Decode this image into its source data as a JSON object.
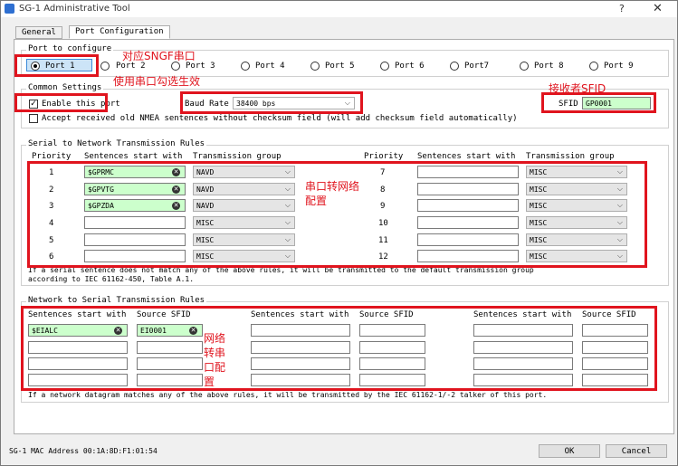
{
  "window": {
    "title": "SG-1 Administrative Tool",
    "help": "?",
    "close": "✕"
  },
  "tabs": [
    "General",
    "Port Configuration"
  ],
  "port_group": {
    "title": "Port to configure",
    "ports": [
      "Port 1",
      "Port 2",
      "Port 3",
      "Port 4",
      "Port 5",
      "Port 6",
      "Port7",
      "Port 8",
      "Port 9"
    ],
    "selected": "Port 1"
  },
  "common": {
    "title": "Common Settings",
    "enable_label": "Enable this port",
    "baud_label": "Baud Rate",
    "baud_value": "38400 bps",
    "sfid_label": "SFID",
    "sfid_value": "GP0001",
    "accept_label": "Accept received old NMEA sentences without checksum field (will add checksum field automatically)"
  },
  "serial_rules": {
    "title": "Serial to Network Transmission Rules",
    "headers": {
      "priority": "Priority",
      "sentence": "Sentences start with",
      "group": "Transmission group"
    },
    "left": [
      {
        "priority": "1",
        "sentence": "$GPRMC",
        "group": "NAVD"
      },
      {
        "priority": "2",
        "sentence": "$GPVTG",
        "group": "NAVD"
      },
      {
        "priority": "3",
        "sentence": "$GPZDA",
        "group": "NAVD"
      },
      {
        "priority": "4",
        "sentence": "",
        "group": "MISC"
      },
      {
        "priority": "5",
        "sentence": "",
        "group": "MISC"
      },
      {
        "priority": "6",
        "sentence": "",
        "group": "MISC"
      }
    ],
    "right": [
      {
        "priority": "7",
        "sentence": "",
        "group": "MISC"
      },
      {
        "priority": "8",
        "sentence": "",
        "group": "MISC"
      },
      {
        "priority": "9",
        "sentence": "",
        "group": "MISC"
      },
      {
        "priority": "10",
        "sentence": "",
        "group": "MISC"
      },
      {
        "priority": "11",
        "sentence": "",
        "group": "MISC"
      },
      {
        "priority": "12",
        "sentence": "",
        "group": "MISC"
      }
    ],
    "note_line1": "If a serial sentence does not match any of the above rules, it will be transmitted to the default transmission group",
    "note_line2": "according to IEC 61162-450, Table A.1."
  },
  "network_rules": {
    "title": "Network to Serial Transmission Rules",
    "headers": {
      "sentence": "Sentences start with",
      "sfid": "Source SFID"
    },
    "col1": [
      {
        "sentence": "$EIALC",
        "sfid": "EI0001"
      },
      {
        "sentence": "",
        "sfid": ""
      },
      {
        "sentence": "",
        "sfid": ""
      },
      {
        "sentence": "",
        "sfid": ""
      }
    ],
    "note": "If a network datagram matches any of the above rules, it will be transmitted by the IEC 61162-1/-2 talker of this port."
  },
  "footer": {
    "mac": "SG-1 MAC Address 00:1A:8D:F1:01:54",
    "ok": "OK",
    "cancel": "Cancel"
  },
  "annotations": {
    "port": "对应SNGF串口",
    "enable": "使用串口勾选生效",
    "sfid": "接收者SFID",
    "s2n_line1": "串口转网络",
    "s2n_line2": "配置",
    "n2s_line1": "网络",
    "n2s_line2": "转串",
    "n2s_line3": "口配",
    "n2s_line4": "置"
  },
  "colors": {
    "annotation": "#e0141e",
    "valid_field": "#ccffcc",
    "selection": "#cce4f7"
  }
}
